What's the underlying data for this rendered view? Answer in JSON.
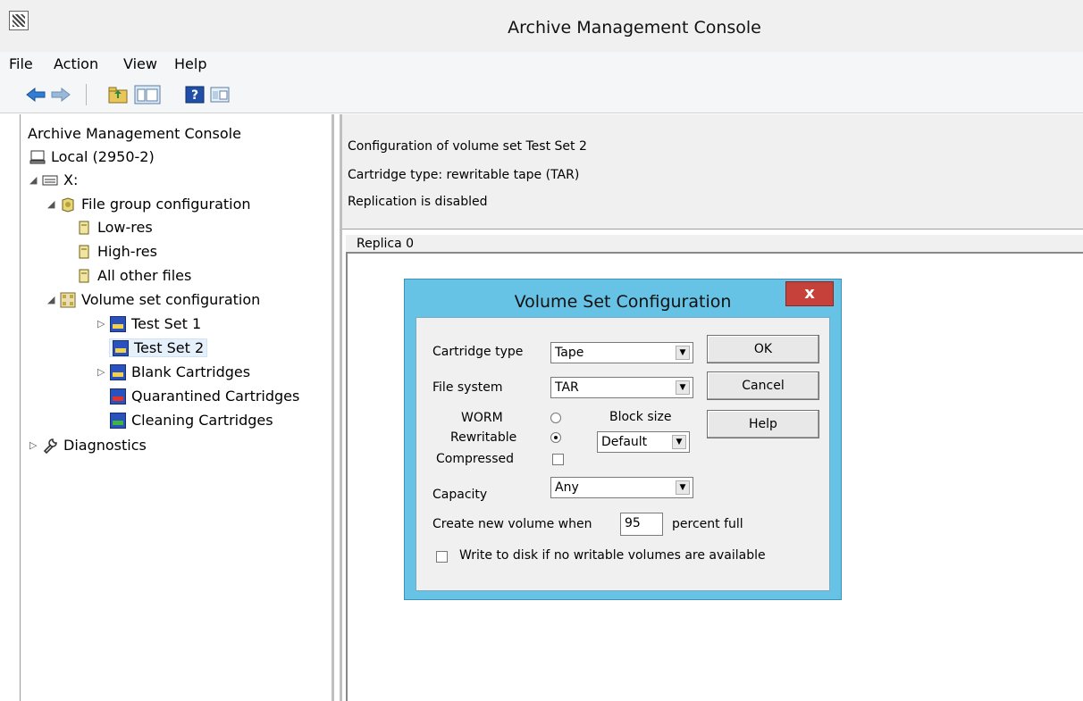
{
  "window": {
    "title": "Archive Management Console"
  },
  "menu": [
    "File",
    "Action",
    "View",
    "Help"
  ],
  "toolbar": {
    "icons": [
      "back-arrow-icon",
      "forward-arrow-icon",
      "up-folder-icon",
      "show-hide-tree-icon",
      "help-icon",
      "properties-icon"
    ]
  },
  "tree": {
    "root": "Archive Management Console",
    "local": "Local (2950-2)",
    "drive": "X:",
    "file_group": "File group configuration",
    "file_groups": [
      "Low-res",
      "High-res",
      "All other files"
    ],
    "volume_set": "Volume set configuration",
    "volume_sets": [
      "Test Set 1",
      "Test Set 2",
      "Blank Cartridges",
      "Quarantined Cartridges",
      "Cleaning Cartridges"
    ],
    "diagnostics": "Diagnostics"
  },
  "info": {
    "line1": "Configuration of volume set Test Set 2",
    "line2": "Cartridge type: rewritable tape (TAR)",
    "line3": "Replication is disabled"
  },
  "replica": {
    "tab": "Replica 0"
  },
  "dialog": {
    "title": "Volume Set Configuration",
    "close": "x",
    "cartridge_type_label": "Cartridge type",
    "cartridge_type_value": "Tape",
    "file_system_label": "File system",
    "file_system_value": "TAR",
    "worm_label": "WORM",
    "rewritable_label": "Rewritable",
    "compressed_label": "Compressed",
    "block_size_label": "Block size",
    "block_size_value": "Default",
    "capacity_label": "Capacity",
    "capacity_value": "Any",
    "create_new_label": "Create new volume when",
    "percent_value": "95",
    "percent_suffix": "percent full",
    "write_to_disk_label": "Write to disk if no writable volumes are available",
    "ok": "OK",
    "cancel": "Cancel",
    "help": "Help"
  }
}
